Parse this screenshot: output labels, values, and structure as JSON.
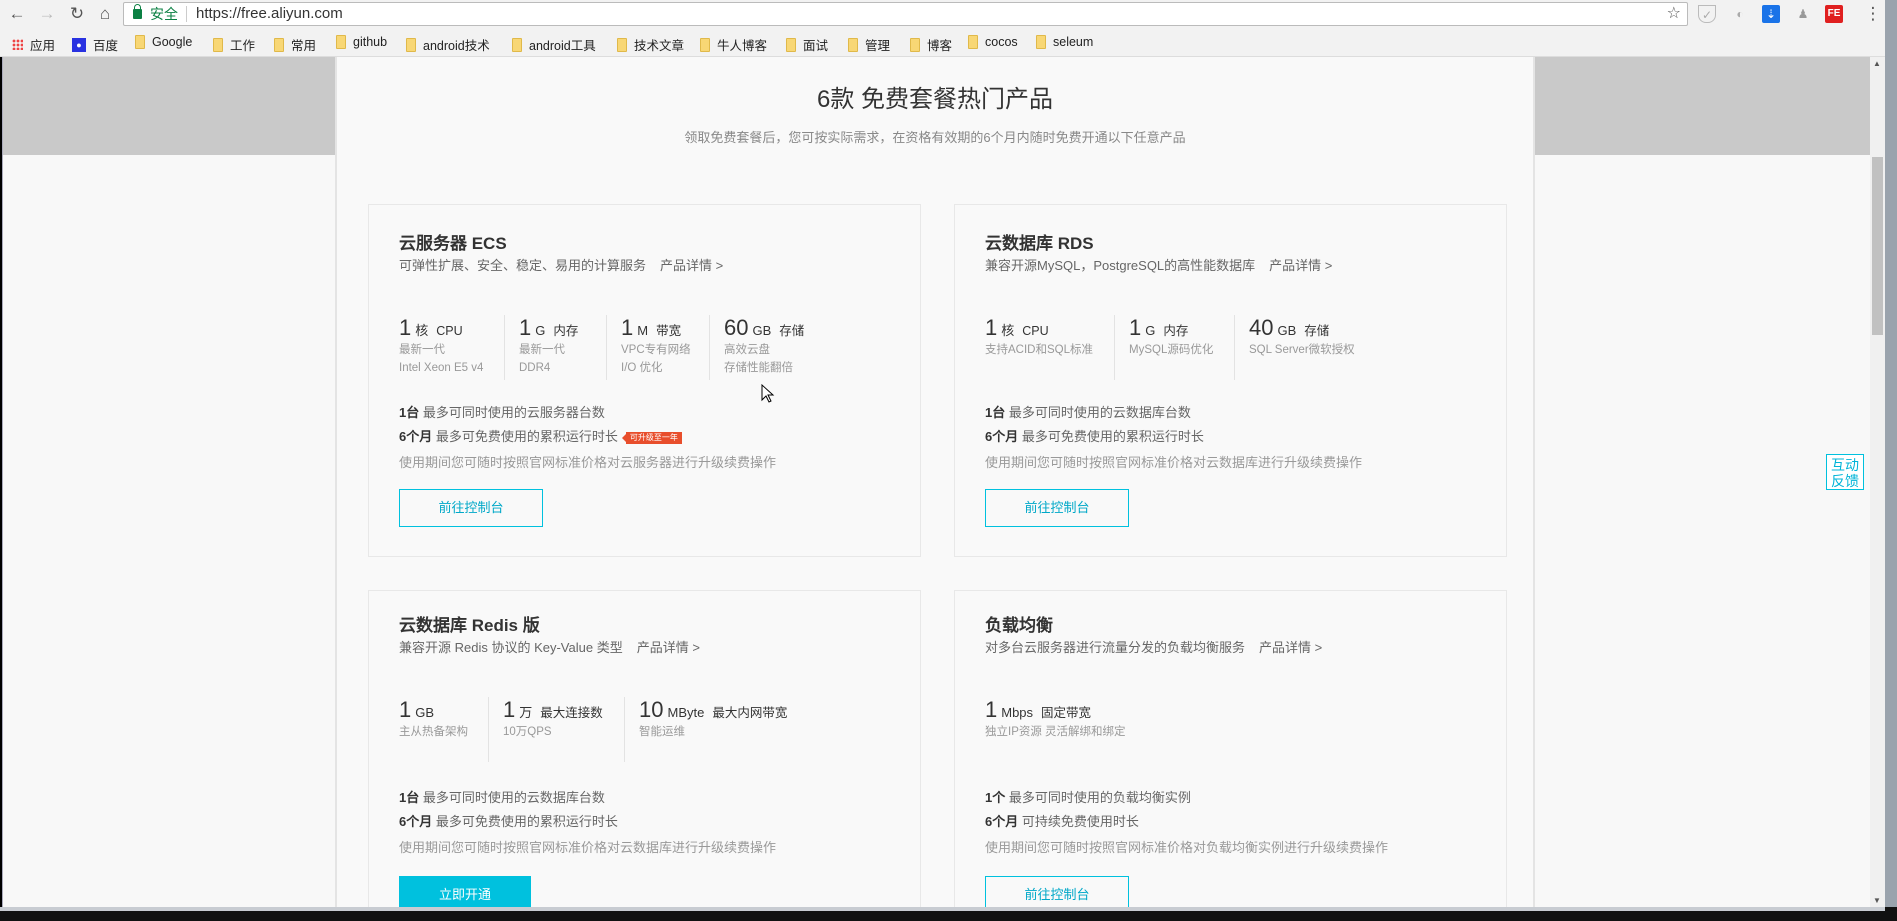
{
  "browser": {
    "secure_label": "安全",
    "url": "https://free.aliyun.com",
    "bookmarks": [
      "应用",
      "百度",
      "Google",
      "工作",
      "常用",
      "github",
      "android技术",
      "android工具",
      "技术文章",
      "牛人博客",
      "面试",
      "管理",
      "博客",
      "cocos",
      "seleum"
    ],
    "extensions": [
      "shield-extension",
      "circle-extension",
      "download-extension",
      "figure-extension",
      "FE"
    ]
  },
  "header": {
    "title": "6款 免费套餐热门产品",
    "subtitle": "领取免费套餐后，您可按实际需求，在资格有效期的6个月内随时免费开通以下任意产品"
  },
  "cards": [
    {
      "title": "云服务器 ECS",
      "desc": "可弹性扩展、安全、稳定、易用的计算服务",
      "detail_link": "产品详情 >",
      "specs": [
        {
          "num": "1",
          "unit": "核",
          "label": "CPU",
          "sub1": "最新一代",
          "sub2": "Intel Xeon E5 v4"
        },
        {
          "num": "1",
          "unit": "G",
          "label": "内存",
          "sub1": "最新一代",
          "sub2": "DDR4"
        },
        {
          "num": "1",
          "unit": "M",
          "label": "带宽",
          "sub1": "VPC专有网络",
          "sub2": "I/O 优化"
        },
        {
          "num": "60",
          "unit": "GB",
          "label": "存储",
          "sub1": "高效云盘",
          "sub2": "存储性能翻倍"
        }
      ],
      "line1_bold": "1台",
      "line1": "最多可同时使用的云服务器台数",
      "line2_bold": "6个月",
      "line2": "最多可免费使用的累积运行时长",
      "badge": "可升级至一年",
      "note": "使用期间您可随时按照官网标准价格对云服务器进行升级续费操作",
      "button": "前往控制台"
    },
    {
      "title": "云数据库 RDS",
      "desc": "兼容开源MySQL，PostgreSQL的高性能数据库",
      "detail_link": "产品详情 >",
      "specs": [
        {
          "num": "1",
          "unit": "核",
          "label": "CPU",
          "sub1": "支持ACID和SQL标准"
        },
        {
          "num": "1",
          "unit": "G",
          "label": "内存",
          "sub1": "MySQL源码优化"
        },
        {
          "num": "40",
          "unit": "GB",
          "label": "存储",
          "sub1": "SQL Server微软授权"
        }
      ],
      "line1_bold": "1台",
      "line1": "最多可同时使用的云数据库台数",
      "line2_bold": "6个月",
      "line2": "最多可免费使用的累积运行时长",
      "note": "使用期间您可随时按照官网标准价格对云数据库进行升级续费操作",
      "button": "前往控制台"
    },
    {
      "title": "云数据库 Redis 版",
      "desc": "兼容开源 Redis 协议的 Key-Value 类型",
      "detail_link": "产品详情 >",
      "specs": [
        {
          "num": "1",
          "unit": "GB",
          "label": "",
          "sub1": "主从热备架构"
        },
        {
          "num": "1",
          "unit": "万",
          "label": "最大连接数",
          "sub1": "10万QPS"
        },
        {
          "num": "10",
          "unit": "MByte",
          "label": "最大内网带宽",
          "sub1": "智能运维"
        }
      ],
      "line1_bold": "1台",
      "line1": "最多可同时使用的云数据库台数",
      "line2_bold": "6个月",
      "line2": "最多可免费使用的累积运行时长",
      "note": "使用期间您可随时按照官网标准价格对云数据库进行升级续费操作",
      "button": "立即开通"
    },
    {
      "title": "负载均衡",
      "desc": "对多台云服务器进行流量分发的负载均衡服务",
      "detail_link": "产品详情 >",
      "specs": [
        {
          "num": "1",
          "unit": "Mbps",
          "label": "固定带宽",
          "sub1": "独立IP资源 灵活解绑和绑定"
        }
      ],
      "line1_bold": "1个",
      "line1": "最多可同时使用的负载均衡实例",
      "line2_bold": "6个月",
      "line2": "可持续免费使用时长",
      "note": "使用期间您可随时按照官网标准价格对负载均衡实例进行升级续费操作",
      "button": "前往控制台"
    }
  ],
  "feedback": {
    "line1": "互动",
    "line2": "反馈"
  },
  "colors": {
    "accent": "#00c1de",
    "badge": "#e84e2c",
    "secure": "#0b8043"
  }
}
